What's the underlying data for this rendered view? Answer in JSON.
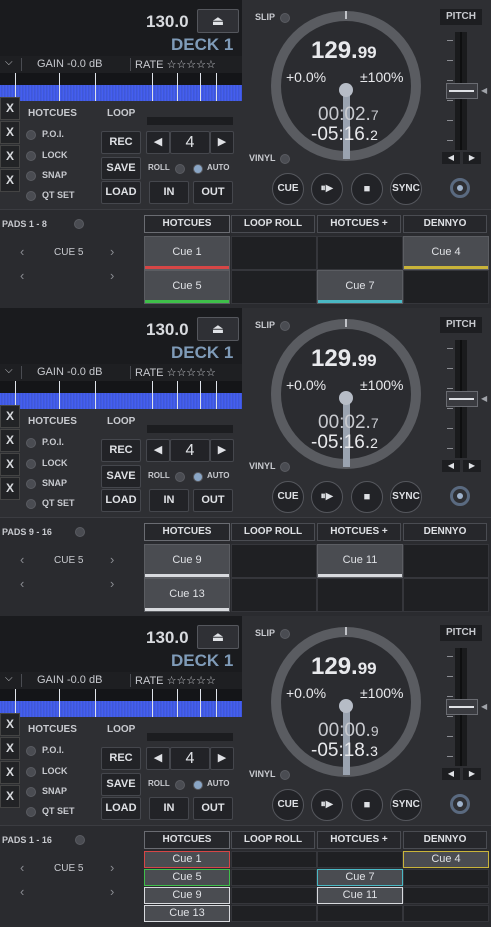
{
  "colors": {
    "red": "#d64646",
    "green": "#3fbf4a",
    "yellow": "#c9b43a",
    "cyan": "#4ab8c4",
    "white": "#d8dade"
  },
  "decks": [
    {
      "bpm": "130.0",
      "eject_icon": "eject-icon",
      "deck_label": "DECK 1",
      "chevron_icon": "chevron-down-icon",
      "gain": "GAIN  -0.0 dB",
      "rate": "RATE ☆☆☆☆☆",
      "hotcues_label": "HOTCUES",
      "x_labels": [
        "X",
        "X",
        "X",
        "X"
      ],
      "hotcue_options": [
        "P.O.I.",
        "LOCK",
        "SNAP",
        "QT SET"
      ],
      "loop_label": "LOOP",
      "rec": "REC",
      "save": "SAVE",
      "load": "LOAD",
      "loop_value": "4",
      "roll": "ROLL",
      "auto": "AUTO",
      "in": "IN",
      "out": "OUT",
      "slip": "SLIP",
      "vinyl": "VINYL",
      "jog_bpm_main": "129.",
      "jog_bpm_dec": "99",
      "pitch_pct": "+0.0%",
      "pitch_range": "±100%",
      "elapsed_main": "00:02.",
      "elapsed_dec": "7",
      "remain_main": "-05:16.",
      "remain_dec": "2",
      "cue": "CUE",
      "play_icon": "play-pause-icon",
      "stop_icon": "stop-icon",
      "sync": "SYNC",
      "pitch_label": "PITCH",
      "pads_label": "PADS  1 - 8",
      "pad_current": "CUE 5",
      "tabs": [
        "HOTCUES",
        "LOOP ROLL",
        "HOTCUES +",
        "DENNYO"
      ],
      "pad_layout": "grid",
      "pads": [
        {
          "label": "Cue 1",
          "color": "#d64646"
        },
        {
          "label": "",
          "color": ""
        },
        {
          "label": "",
          "color": ""
        },
        {
          "label": "Cue 4",
          "color": "#c9b43a"
        },
        {
          "label": "Cue 5",
          "color": "#3fbf4a"
        },
        {
          "label": "",
          "color": ""
        },
        {
          "label": "Cue 7",
          "color": "#4ab8c4"
        },
        {
          "label": "",
          "color": ""
        }
      ]
    },
    {
      "bpm": "130.0",
      "eject_icon": "eject-icon",
      "deck_label": "DECK 1",
      "chevron_icon": "chevron-down-icon",
      "gain": "GAIN  -0.0 dB",
      "rate": "RATE ☆☆☆☆☆",
      "hotcues_label": "HOTCUES",
      "x_labels": [
        "X",
        "X",
        "X",
        "X"
      ],
      "hotcue_options": [
        "P.O.I.",
        "LOCK",
        "SNAP",
        "QT SET"
      ],
      "loop_label": "LOOP",
      "rec": "REC",
      "save": "SAVE",
      "load": "LOAD",
      "loop_value": "4",
      "roll": "ROLL",
      "auto": "AUTO",
      "in": "IN",
      "out": "OUT",
      "slip": "SLIP",
      "vinyl": "VINYL",
      "jog_bpm_main": "129.",
      "jog_bpm_dec": "99",
      "pitch_pct": "+0.0%",
      "pitch_range": "±100%",
      "elapsed_main": "00:02.",
      "elapsed_dec": "7",
      "remain_main": "-05:16.",
      "remain_dec": "2",
      "cue": "CUE",
      "play_icon": "play-pause-icon",
      "stop_icon": "stop-icon",
      "sync": "SYNC",
      "pitch_label": "PITCH",
      "pads_label": "PADS  9 - 16",
      "pad_current": "CUE 5",
      "tabs": [
        "HOTCUES",
        "LOOP ROLL",
        "HOTCUES +",
        "DENNYO"
      ],
      "pad_layout": "grid",
      "pads": [
        {
          "label": "Cue 9",
          "color": "#d8dade"
        },
        {
          "label": "",
          "color": ""
        },
        {
          "label": "Cue 11",
          "color": "#d8dade"
        },
        {
          "label": "",
          "color": ""
        },
        {
          "label": "Cue 13",
          "color": "#d8dade"
        },
        {
          "label": "",
          "color": ""
        },
        {
          "label": "",
          "color": ""
        },
        {
          "label": "",
          "color": ""
        }
      ]
    },
    {
      "bpm": "130.0",
      "eject_icon": "eject-icon",
      "deck_label": "DECK 1",
      "chevron_icon": "chevron-down-icon",
      "gain": "GAIN  -0.0 dB",
      "rate": "RATE ☆☆☆☆☆",
      "hotcues_label": "HOTCUES",
      "x_labels": [
        "X",
        "X",
        "X",
        "X"
      ],
      "hotcue_options": [
        "P.O.I.",
        "LOCK",
        "SNAP",
        "QT SET"
      ],
      "loop_label": "LOOP",
      "rec": "REC",
      "save": "SAVE",
      "load": "LOAD",
      "loop_value": "4",
      "roll": "ROLL",
      "auto": "AUTO",
      "in": "IN",
      "out": "OUT",
      "slip": "SLIP",
      "vinyl": "VINYL",
      "jog_bpm_main": "129.",
      "jog_bpm_dec": "99",
      "pitch_pct": "+0.0%",
      "pitch_range": "±100%",
      "elapsed_main": "00:00.",
      "elapsed_dec": "9",
      "remain_main": "-05:18.",
      "remain_dec": "3",
      "cue": "CUE",
      "play_icon": "play-pause-icon",
      "stop_icon": "stop-icon",
      "sync": "SYNC",
      "pitch_label": "PITCH",
      "pads_label": "PADS  1 - 16",
      "pad_current": "CUE 5",
      "tabs": [
        "HOTCUES",
        "LOOP ROLL",
        "HOTCUES +",
        "DENNYO"
      ],
      "pad_layout": "list",
      "pads": [
        {
          "label": "Cue 1",
          "color": "#d64646"
        },
        {
          "label": "",
          "color": ""
        },
        {
          "label": "",
          "color": ""
        },
        {
          "label": "Cue 4",
          "color": "#c9b43a"
        },
        {
          "label": "Cue 5",
          "color": "#3fbf4a"
        },
        {
          "label": "",
          "color": ""
        },
        {
          "label": "Cue 7",
          "color": "#4ab8c4"
        },
        {
          "label": "",
          "color": ""
        },
        {
          "label": "Cue 9",
          "color": "#d8dade"
        },
        {
          "label": "",
          "color": ""
        },
        {
          "label": "Cue 11",
          "color": "#d8dade"
        },
        {
          "label": "",
          "color": ""
        },
        {
          "label": "Cue 13",
          "color": "#d8dade"
        },
        {
          "label": "",
          "color": ""
        },
        {
          "label": "",
          "color": ""
        },
        {
          "label": "",
          "color": ""
        }
      ]
    }
  ]
}
